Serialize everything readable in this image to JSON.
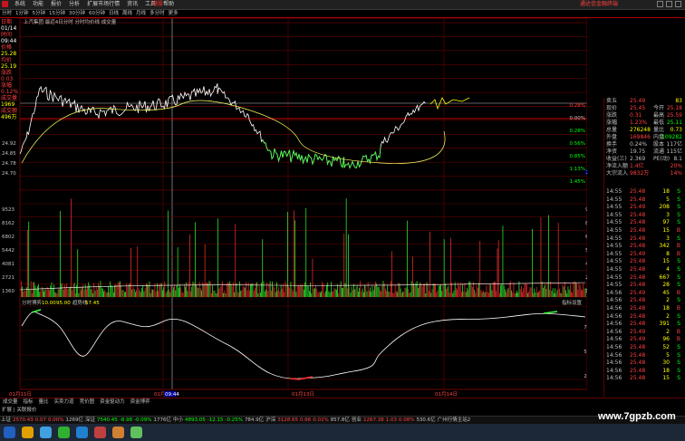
{
  "menu": {
    "items": [
      "系统",
      "功能",
      "报价",
      "分析",
      "扩展市场行情",
      "资讯",
      "工具",
      "帮助"
    ],
    "active": "港股",
    "brand": "通达信金融终端"
  },
  "periodbar": [
    "分时",
    "1分钟",
    "5分钟",
    "15分钟",
    "30分钟",
    "60分钟",
    "日线",
    "周线",
    "月线",
    "多分时",
    "更多"
  ],
  "chart_header": "上汽集团 最近4日分时 分时均价线 成交量",
  "left_panel": [
    {
      "label": "日期",
      "color": "#ff4040"
    },
    {
      "label": "01/14",
      "color": "#ffffff"
    },
    {
      "label": "时间",
      "color": "#ff4040"
    },
    {
      "label": "09:44",
      "color": "#ffffff"
    },
    {
      "label": "价格",
      "color": "#ff4040"
    },
    {
      "label": "25.28",
      "color": "#ffff00"
    },
    {
      "label": "均价",
      "color": "#ff4040"
    },
    {
      "label": "25.19",
      "color": "#ffff00"
    },
    {
      "label": "涨跌",
      "color": "#ff4040"
    },
    {
      "label": "0.03",
      "color": "#ff4040"
    },
    {
      "label": "涨幅",
      "color": "#ff4040"
    },
    {
      "label": "0.12%",
      "color": "#ff4040"
    },
    {
      "label": "成交量",
      "color": "#ff4040"
    },
    {
      "label": "1969",
      "color": "#ffff00"
    },
    {
      "label": "成交额",
      "color": "#ff4040"
    },
    {
      "label": "496万",
      "color": "#ffff00"
    }
  ],
  "price_axis_left": [
    "24.92",
    "24.85",
    "24.78",
    "24.70"
  ],
  "volume_axis_left": [
    "9523",
    "8162",
    "6802",
    "5442",
    "4081",
    "2721",
    "1360"
  ],
  "volume_axis_right": [
    "9523",
    "8162",
    "6802",
    "5442",
    "4081",
    "2721",
    "1360"
  ],
  "pct_axis_right": [
    "0.28%",
    "0.00%",
    "0.28%",
    "0.56%",
    "0.85%",
    "1.13%",
    "1.45%"
  ],
  "indicator_header": {
    "name": "分时博弈",
    "v1": "10.00",
    "v2": "95.00",
    "label2": "趋势线",
    "v3": "57.45"
  },
  "indicator_axis": [
    "75.77",
    "51.54",
    "27.31"
  ],
  "indicator_setting": "指标设置",
  "date_markers": [
    "01月11日",
    "01月12日",
    "01月13日",
    "01月14日"
  ],
  "cursor_time": "09:44",
  "cursor_price": "24.92",
  "quote": [
    {
      "a": "卖五",
      "b": "25.49",
      "c": "83",
      "bc": "#ff4040"
    },
    {
      "a": "现价",
      "b": "25.45",
      "c2": "今开",
      "d": "25.18",
      "bc": "#ff4040",
      "dc": "#ff4040"
    },
    {
      "a": "涨跌",
      "b": "0.31",
      "c2": "最高",
      "d": "25.59",
      "bc": "#ff4040",
      "dc": "#ff4040"
    },
    {
      "a": "涨幅",
      "b": "1.23%",
      "c2": "最低",
      "d": "25.11",
      "bc": "#ff4040",
      "dc": "#00ff00"
    },
    {
      "a": "总量",
      "b": "276248",
      "c2": "量比",
      "d": "0.73",
      "bc": "#ffff00",
      "dc": "#ffff00"
    },
    {
      "a": "外盘",
      "b": "169846",
      "c2": "内盘",
      "d": "109282",
      "bc": "#ff4040",
      "dc": "#00ff00"
    },
    {
      "a": "换手",
      "b": "0.24%",
      "c2": "股本",
      "d": "117亿",
      "bc": "#c0c0c0",
      "dc": "#c0c0c0"
    },
    {
      "a": "净资",
      "b": "19.75",
      "c2": "流通",
      "d": "115亿",
      "bc": "#c0c0c0",
      "dc": "#c0c0c0"
    },
    {
      "a": "收益(三)",
      "b": "2.369",
      "c2": "PE(动)",
      "d": "8.1",
      "bc": "#c0c0c0",
      "dc": "#c0c0c0"
    },
    {
      "a": "净流入额",
      "b": "1.4亿",
      "d": "20%",
      "bc": "#ff4040",
      "dc": "#ff4040"
    },
    {
      "a": "大宗流入",
      "b": "9832万",
      "d": "14%",
      "bc": "#ff4040",
      "dc": "#ff4040"
    }
  ],
  "ticks": [
    {
      "t": "14:55",
      "p": "25.48",
      "v": "18",
      "d": "S"
    },
    {
      "t": "14:55",
      "p": "25.48",
      "v": "5",
      "d": "S"
    },
    {
      "t": "14:55",
      "p": "25.49",
      "v": "208",
      "d": "S"
    },
    {
      "t": "14:55",
      "p": "25.48",
      "v": "3",
      "d": "S"
    },
    {
      "t": "14:55",
      "p": "25.48",
      "v": "97",
      "d": "S"
    },
    {
      "t": "14:55",
      "p": "25.48",
      "v": "15",
      "d": "B"
    },
    {
      "t": "14:55",
      "p": "25.48",
      "v": "3",
      "d": "S"
    },
    {
      "t": "14:55",
      "p": "25.48",
      "v": "342",
      "d": "B"
    },
    {
      "t": "14:55",
      "p": "25.49",
      "v": "8",
      "d": "B"
    },
    {
      "t": "14:55",
      "p": "25.48",
      "v": "15",
      "d": "S"
    },
    {
      "t": "14:55",
      "p": "25.48",
      "v": "4",
      "d": "S"
    },
    {
      "t": "14:55",
      "p": "25.48",
      "v": "667",
      "d": "S"
    },
    {
      "t": "14:55",
      "p": "25.48",
      "v": "28",
      "d": "S"
    },
    {
      "t": "14:56",
      "p": "25.49",
      "v": "45",
      "d": "B"
    },
    {
      "t": "14:56",
      "p": "25.48",
      "v": "2",
      "d": "S"
    },
    {
      "t": "14:56",
      "p": "25.48",
      "v": "18",
      "d": "B"
    },
    {
      "t": "14:56",
      "p": "25.48",
      "v": "2",
      "d": "S"
    },
    {
      "t": "14:56",
      "p": "25.48",
      "v": "391",
      "d": "S"
    },
    {
      "t": "14:56",
      "p": "25.49",
      "v": "2",
      "d": "B"
    },
    {
      "t": "14:56",
      "p": "25.49",
      "v": "96",
      "d": "B"
    },
    {
      "t": "14:56",
      "p": "25.48",
      "v": "52",
      "d": "S"
    },
    {
      "t": "14:56",
      "p": "25.48",
      "v": "5",
      "d": "S"
    },
    {
      "t": "14:56",
      "p": "25.48",
      "v": "30",
      "d": "S"
    },
    {
      "t": "14:56",
      "p": "25.48",
      "v": "18",
      "d": "S"
    },
    {
      "t": "14:56",
      "p": "25.48",
      "v": "15",
      "d": "S"
    }
  ],
  "bottom_tabs": [
    "成交量",
    "指标",
    "量比",
    "买卖力道",
    "竞价图",
    "资金驱动力",
    "资金博弈"
  ],
  "status_left": "扩展 | 关联报价",
  "ticker": [
    {
      "t": "上证",
      "c": "#c0c0c0"
    },
    {
      "t": "2570.43",
      "c": "#ff4040"
    },
    {
      "t": "0.07",
      "c": "#ff4040"
    },
    {
      "t": "0.00%",
      "c": "#ff4040"
    },
    {
      "t": "1269亿",
      "c": "#c0c0c0"
    },
    {
      "t": "深证",
      "c": "#c0c0c0"
    },
    {
      "t": "7540.45",
      "c": "#00ff00"
    },
    {
      "t": "-8.98",
      "c": "#00ff00"
    },
    {
      "t": "-0.09%",
      "c": "#00ff00"
    },
    {
      "t": "1776亿",
      "c": "#c0c0c0"
    },
    {
      "t": "中小",
      "c": "#c0c0c0"
    },
    {
      "t": "4893.05",
      "c": "#00ff00"
    },
    {
      "t": "-12.15",
      "c": "#00ff00"
    },
    {
      "t": "-0.25%",
      "c": "#00ff00"
    },
    {
      "t": "784.9亿",
      "c": "#c0c0c0"
    },
    {
      "t": "沪深",
      "c": "#c0c0c0"
    },
    {
      "t": "3128.65",
      "c": "#ff4040"
    },
    {
      "t": "0.66",
      "c": "#ff4040"
    },
    {
      "t": "0.02%",
      "c": "#ff4040"
    },
    {
      "t": "857.8亿",
      "c": "#c0c0c0"
    },
    {
      "t": "创业",
      "c": "#c0c0c0"
    },
    {
      "t": "1267.38",
      "c": "#ff4040"
    },
    {
      "t": "1.03",
      "c": "#ff4040"
    },
    {
      "t": "0.08%",
      "c": "#ff4040"
    },
    {
      "t": "530.6亿",
      "c": "#c0c0c0"
    },
    {
      "t": "广州行情主站2",
      "c": "#c0c0c0"
    }
  ],
  "watermark": "www.7gpzb.com",
  "colors": {
    "up": "#ff4040",
    "down": "#00ff00",
    "avg": "#ffff00",
    "grid": "#600000",
    "line": "#ffffff"
  }
}
